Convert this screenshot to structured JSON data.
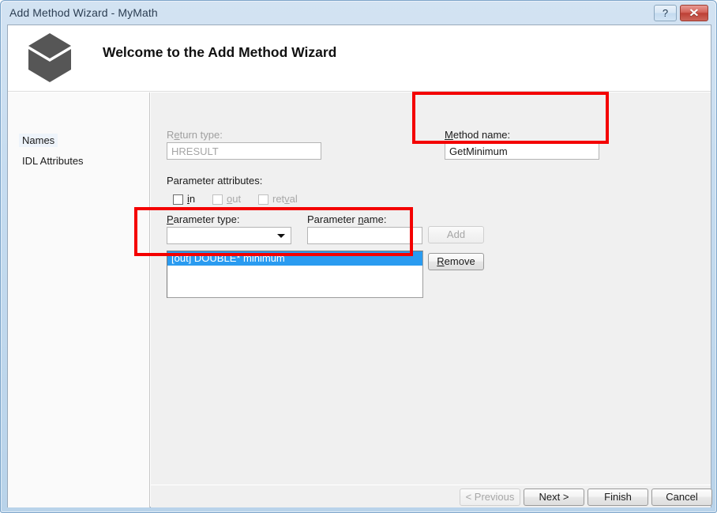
{
  "window": {
    "title": "Add Method Wizard - MyMath",
    "help_button": "?",
    "close_button": "✕"
  },
  "header": {
    "icon": "cube-icon",
    "title": "Welcome to the Add Method Wizard"
  },
  "sidebar": {
    "items": [
      {
        "label": "Names",
        "selected": true
      },
      {
        "label": "IDL Attributes",
        "selected": false
      }
    ]
  },
  "form": {
    "return_type": {
      "label": "Return type:",
      "accel": "e",
      "value": "HRESULT",
      "enabled": false
    },
    "method_name": {
      "label": "Method name:",
      "accel": "M",
      "value": "GetMinimum",
      "placeholder": "",
      "enabled": true
    },
    "parameter_attributes": {
      "label": "Parameter attributes:",
      "checkboxes": [
        {
          "label": "in",
          "accel": "i",
          "checked": false,
          "enabled": true
        },
        {
          "label": "out",
          "accel": "o",
          "checked": false,
          "enabled": false
        },
        {
          "label": "retval",
          "accel": "v",
          "checked": false,
          "enabled": false
        }
      ]
    },
    "parameter_type": {
      "label": "Parameter type:",
      "accel": "P",
      "value": "",
      "options": []
    },
    "parameter_name": {
      "label": "Parameter name:",
      "accel": "n",
      "value": "",
      "placeholder": ""
    },
    "add_button": {
      "label": "Add",
      "accel": "A",
      "enabled": false
    },
    "remove_button": {
      "label": "Remove",
      "accel": "R",
      "enabled": true
    },
    "parameter_list": {
      "items": [
        {
          "text": "[out] DOUBLE* minimum",
          "selected": true
        }
      ]
    }
  },
  "footer": {
    "buttons": [
      {
        "label": "< Previous",
        "enabled": false
      },
      {
        "label": "Next >",
        "enabled": true
      },
      {
        "label": "Finish",
        "enabled": true
      },
      {
        "label": "Cancel",
        "enabled": true
      }
    ]
  },
  "annotations": {
    "accent_color": "#f40000",
    "boxes": [
      {
        "target": "method-name-group"
      },
      {
        "target": "parameter-list-group"
      }
    ]
  }
}
